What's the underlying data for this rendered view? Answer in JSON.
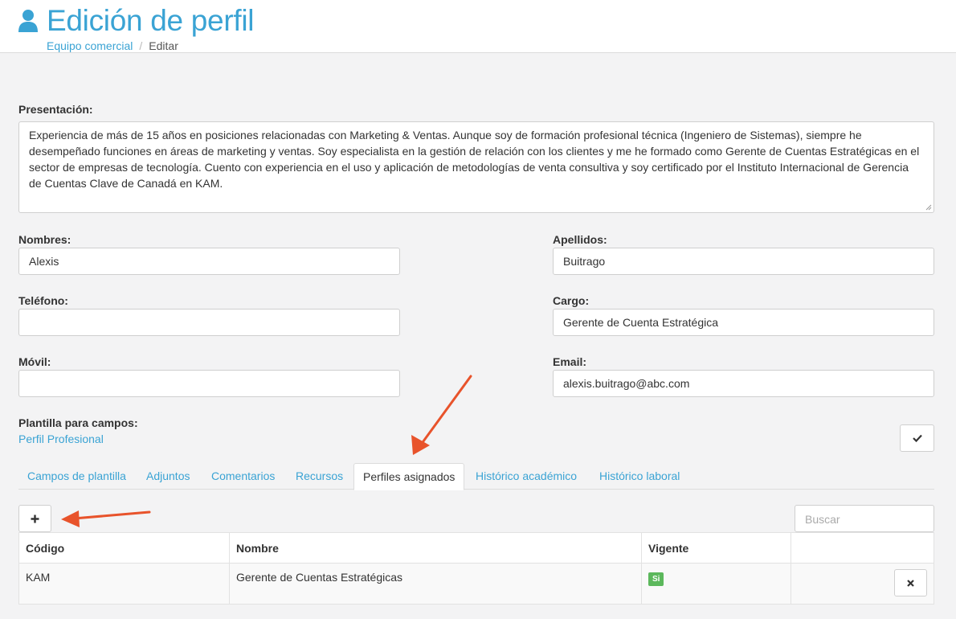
{
  "header": {
    "title": "Edición de perfil",
    "breadcrumb": {
      "link": "Equipo comercial",
      "separator": "/",
      "current": "Editar"
    }
  },
  "form": {
    "presentacion_label": "Presentación:",
    "presentacion_value": "Experiencia de más de 15 años en posiciones relacionadas con Marketing & Ventas. Aunque soy de formación profesional técnica (Ingeniero de Sistemas), siempre he desempeñado funciones en áreas de marketing y ventas. Soy especialista en la gestión de relación con los clientes y me he formado como Gerente de Cuentas Estratégicas en el sector de empresas de tecnología. Cuento con experiencia en el uso y aplicación de metodologías de venta consultiva y soy certificado por el Instituto Internacional de Gerencia de Cuentas Clave de Canadá en KAM.",
    "nombres_label": "Nombres:",
    "nombres_value": "Alexis",
    "apellidos_label": "Apellidos:",
    "apellidos_value": "Buitrago",
    "telefono_label": "Teléfono:",
    "telefono_value": "",
    "cargo_label": "Cargo:",
    "cargo_value": "Gerente de Cuenta Estratégica",
    "movil_label": "Móvil:",
    "movil_value": "",
    "email_label": "Email:",
    "email_value": "alexis.buitrago@abc.com",
    "plantilla_label": "Plantilla para campos:",
    "plantilla_value": "Perfil Profesional",
    "confirm_icon": "check-icon"
  },
  "tabs": [
    {
      "label": "Campos de plantilla"
    },
    {
      "label": "Adjuntos"
    },
    {
      "label": "Comentarios"
    },
    {
      "label": "Recursos"
    },
    {
      "label": "Perfiles asignados",
      "active": true
    },
    {
      "label": "Histórico académico"
    },
    {
      "label": "Histórico laboral"
    }
  ],
  "toolbar": {
    "add_icon": "plus-icon",
    "search_placeholder": "Buscar"
  },
  "table": {
    "columns": [
      "Código",
      "Nombre",
      "Vigente",
      ""
    ],
    "rows": [
      {
        "codigo": "KAM",
        "nombre": "Gerente de Cuentas Estratégicas",
        "vigente": "Si",
        "delete_icon": "close-icon"
      }
    ]
  },
  "colors": {
    "accent": "#3aa3d4",
    "success": "#5cb85c",
    "annotation_arrow": "#e8532b"
  }
}
